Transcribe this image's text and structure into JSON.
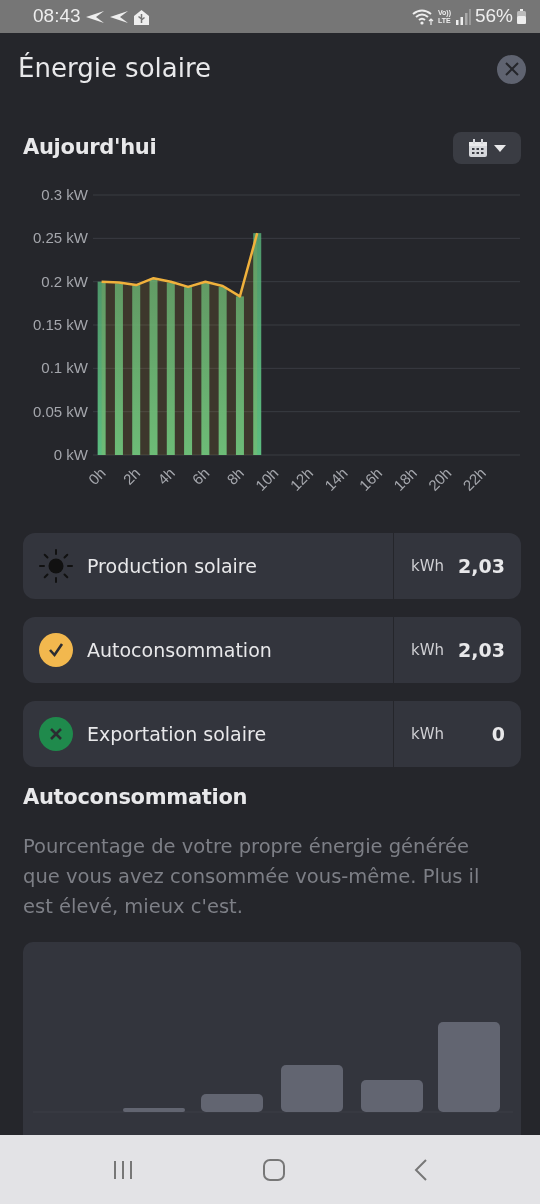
{
  "status_bar": {
    "time": "08:43",
    "network": [
      "Vo))",
      "LTE"
    ],
    "battery": "56%"
  },
  "dialog": {
    "title": "Énergie solaire"
  },
  "today": {
    "title": "Aujourd'hui",
    "chart_data": {
      "type": "bar",
      "x": [
        0,
        1,
        2,
        3,
        4,
        5,
        6,
        7,
        8,
        9
      ],
      "xlim": [
        -0.5,
        24.2
      ],
      "grid": true,
      "ylim": [
        0,
        0.3
      ],
      "xticks": [
        {
          "value": 0,
          "label": "0h"
        },
        {
          "value": 2,
          "label": "2h"
        },
        {
          "value": 4,
          "label": "4h"
        },
        {
          "value": 6,
          "label": "6h"
        },
        {
          "value": 8,
          "label": "8h"
        },
        {
          "value": 10,
          "label": "10h"
        },
        {
          "value": 12,
          "label": "12h"
        },
        {
          "value": 14,
          "label": "14h"
        },
        {
          "value": 16,
          "label": "16h"
        },
        {
          "value": 18,
          "label": "18h"
        },
        {
          "value": 20,
          "label": "20h"
        },
        {
          "value": 22,
          "label": "22h"
        }
      ],
      "yticks": [
        {
          "value": 0,
          "label": "0 kW"
        },
        {
          "value": 0.05,
          "label": "0.05 kW"
        },
        {
          "value": 0.1,
          "label": "0.1 kW"
        },
        {
          "value": 0.15,
          "label": "0.15 kW"
        },
        {
          "value": 0.2,
          "label": "0.2 kW"
        },
        {
          "value": 0.25,
          "label": "0.25 kW"
        },
        {
          "value": 0.3,
          "label": "0.3 kW"
        }
      ],
      "series": [
        {
          "type": "bar",
          "color": "#5cbd80",
          "values": [
            0.2,
            0.198,
            0.196,
            0.203,
            0.199,
            0.194,
            0.199,
            0.194,
            0.183,
            0.256
          ]
        },
        {
          "type": "line",
          "color": "#f0b13c",
          "values": [
            0.2,
            0.199,
            0.196,
            0.204,
            0.2,
            0.194,
            0.2,
            0.195,
            0.183,
            0.256
          ]
        }
      ]
    }
  },
  "stats": [
    {
      "kind": "production",
      "label": "Production solaire",
      "unit": "kWh",
      "value": "2,03"
    },
    {
      "kind": "consumption",
      "label": "Autoconsommation",
      "unit": "kWh",
      "value": "2,03"
    },
    {
      "kind": "export",
      "label": "Exportation solaire",
      "unit": "kWh",
      "value": "0"
    }
  ],
  "self_consumption": {
    "title": "Autoconsommation",
    "description": "Pourcentage de votre propre énergie générée que vous avez consommée vous-même. Plus il est élevé, mieux c'est."
  }
}
